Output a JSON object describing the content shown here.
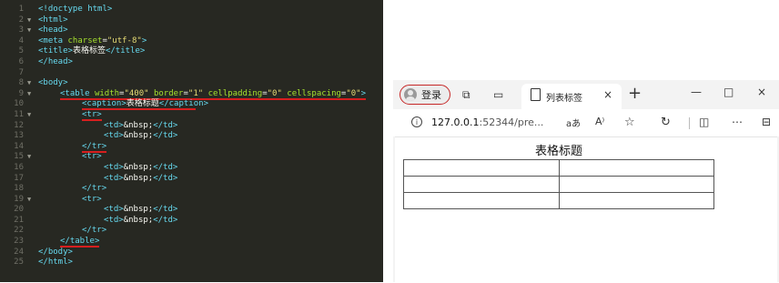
{
  "editor": {
    "lines": [
      {
        "num": "1",
        "fold": "",
        "text": "<!doctype html>",
        "indent": 0
      },
      {
        "num": "2",
        "fold": "▼",
        "text": "<html>",
        "indent": 0
      },
      {
        "num": "3",
        "fold": "▼",
        "text": "<head>",
        "indent": 0
      },
      {
        "num": "4",
        "fold": "",
        "text": "<meta charset=\"utf-8\">",
        "indent": 0
      },
      {
        "num": "5",
        "fold": "",
        "text": "<title>表格标签</title>",
        "indent": 0
      },
      {
        "num": "6",
        "fold": "",
        "text": "</head>",
        "indent": 0
      },
      {
        "num": "7",
        "fold": "",
        "text": "",
        "indent": 0
      },
      {
        "num": "8",
        "fold": "▼",
        "text": "<body>",
        "indent": 0
      },
      {
        "num": "9",
        "fold": "▼",
        "text": "<table width=\"400\" border=\"1\" cellpadding=\"0\" cellspacing=\"0\">",
        "indent": 1
      },
      {
        "num": "10",
        "fold": "",
        "text": "<caption>表格标题</caption>",
        "indent": 2
      },
      {
        "num": "11",
        "fold": "▼",
        "text": "<tr>",
        "indent": 2
      },
      {
        "num": "12",
        "fold": "",
        "text": "<td>&nbsp;</td>",
        "indent": 3
      },
      {
        "num": "13",
        "fold": "",
        "text": "<td>&nbsp;</td>",
        "indent": 3
      },
      {
        "num": "14",
        "fold": "",
        "text": "</tr>",
        "indent": 2
      },
      {
        "num": "15",
        "fold": "▼",
        "text": "<tr>",
        "indent": 2
      },
      {
        "num": "16",
        "fold": "",
        "text": "<td>&nbsp;</td>",
        "indent": 3
      },
      {
        "num": "17",
        "fold": "",
        "text": "<td>&nbsp;</td>",
        "indent": 3
      },
      {
        "num": "18",
        "fold": "",
        "text": "</tr>",
        "indent": 2
      },
      {
        "num": "19",
        "fold": "▼",
        "text": "<tr>",
        "indent": 2
      },
      {
        "num": "20",
        "fold": "",
        "text": "<td>&nbsp;</td>",
        "indent": 3
      },
      {
        "num": "21",
        "fold": "",
        "text": "<td>&nbsp;</td>",
        "indent": 3
      },
      {
        "num": "22",
        "fold": "",
        "text": "</tr>",
        "indent": 2
      },
      {
        "num": "23",
        "fold": "",
        "text": "</table>",
        "indent": 1
      },
      {
        "num": "24",
        "fold": "",
        "text": "</body>",
        "indent": 0
      },
      {
        "num": "25",
        "fold": "",
        "text": "</html>",
        "indent": 0
      }
    ],
    "colors": {
      "background": "#272822",
      "tag": "#66d9ef",
      "attr": "#a6e22e",
      "string": "#e6db74",
      "text": "#f8f8f2",
      "underline": "#d61f1f"
    }
  },
  "browser": {
    "profile_label": "登录",
    "tab_title": "列表标签",
    "tab_close": "×",
    "new_tab": "+",
    "window_controls": {
      "minimize": "—",
      "maximize": "□",
      "close": "×"
    },
    "url_host": "127.0.0.1",
    "url_rest": ":52344/pre...",
    "toolbar_icons": [
      "read-aloud-icon",
      "text-size-icon",
      "favorite-icon",
      "extensions-icon",
      "split-screen-icon",
      "more-icon",
      "sidebar-icon"
    ],
    "page": {
      "caption": "表格标题",
      "rows": 3,
      "cols": 2
    }
  }
}
